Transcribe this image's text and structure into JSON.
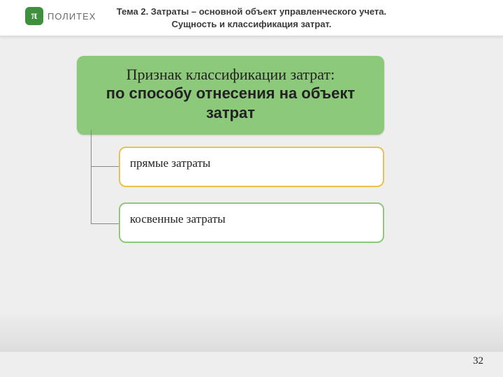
{
  "logo": {
    "mark": "π",
    "text": "ПОЛИТЕХ"
  },
  "header": {
    "title_line1": "Тема 2. Затраты – основной объект управленческого учета.",
    "title_line2": "Сущность и классификация затрат."
  },
  "main": {
    "line1": "Признак классификации затрат:",
    "line2": "по способу отнесения на объект затрат"
  },
  "children": [
    {
      "label": "прямые затраты"
    },
    {
      "label": "косвенные затраты"
    }
  ],
  "page_number": "32"
}
